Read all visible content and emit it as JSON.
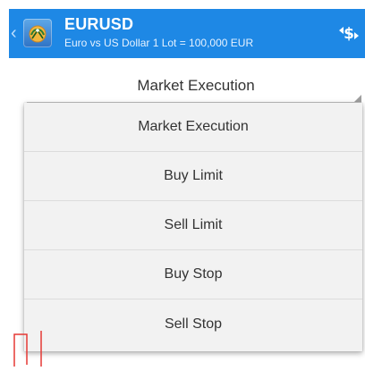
{
  "header": {
    "symbol": "EURUSD",
    "description": "Euro vs US Dollar 1 Lot = 100,000 EUR",
    "accent_color": "#1e88e5",
    "back_icon": "chevron-left-icon",
    "app_icon": "metatrader-app-icon",
    "trade_icon": "trade-icon"
  },
  "order_type": {
    "selected": "Market Execution"
  },
  "dropdown": {
    "options": [
      "Market Execution",
      "Buy Limit",
      "Sell Limit",
      "Buy Stop",
      "Sell Stop"
    ]
  },
  "colors": {
    "chart_line": "#e53935"
  }
}
